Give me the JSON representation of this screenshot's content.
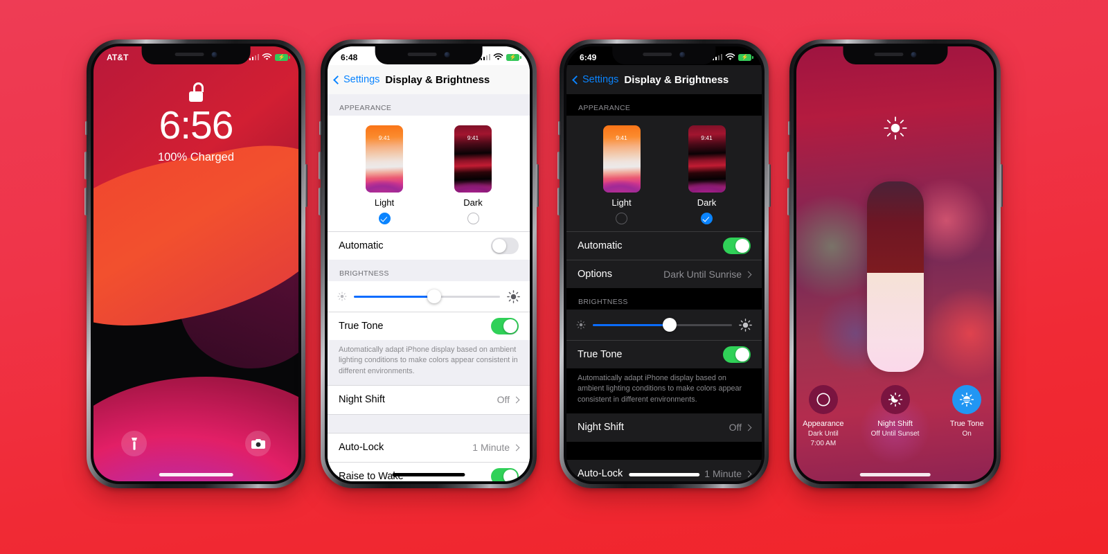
{
  "background": {
    "top_color": "#ee3c55",
    "bottom_color": "#f1242a"
  },
  "accent": {
    "blue": "#0a84ff",
    "green": "#30d158",
    "slider_blue": "#0a6cff"
  },
  "phone1": {
    "name": "lock-screen",
    "statusbar": {
      "carrier": "AT&T",
      "battery_charging": true
    },
    "time": "6:56",
    "charge_status": "100% Charged",
    "unlock_icon": "unlock-icon",
    "left_action_icon": "flashlight-icon",
    "right_action_icon": "camera-icon"
  },
  "phone2": {
    "name": "display-brightness-light",
    "statusbar": {
      "time": "6:48",
      "battery_charging": true
    },
    "nav": {
      "back_label": "Settings",
      "title": "Display & Brightness"
    },
    "appearance": {
      "header": "APPEARANCE",
      "options": [
        {
          "label": "Light",
          "selected": true,
          "thumb_time": "9:41"
        },
        {
          "label": "Dark",
          "selected": false,
          "thumb_time": "9:41"
        }
      ],
      "automatic_label": "Automatic",
      "automatic_on": false
    },
    "brightness": {
      "header": "BRIGHTNESS",
      "slider_percent": 55,
      "true_tone_label": "True Tone",
      "true_tone_on": true,
      "footnote": "Automatically adapt iPhone display based on ambient lighting conditions to make colors appear consistent in different environments.",
      "night_shift_label": "Night Shift",
      "night_shift_value": "Off"
    },
    "lock_section": {
      "auto_lock_label": "Auto-Lock",
      "auto_lock_value": "1 Minute",
      "raise_to_wake_label": "Raise to Wake",
      "raise_to_wake_on": true
    }
  },
  "phone3": {
    "name": "display-brightness-dark",
    "statusbar": {
      "time": "6:49",
      "battery_charging": true
    },
    "nav": {
      "back_label": "Settings",
      "title": "Display & Brightness"
    },
    "appearance": {
      "header": "APPEARANCE",
      "options": [
        {
          "label": "Light",
          "selected": false,
          "thumb_time": "9:41"
        },
        {
          "label": "Dark",
          "selected": true,
          "thumb_time": "9:41"
        }
      ],
      "automatic_label": "Automatic",
      "automatic_on": true,
      "options_label": "Options",
      "options_value": "Dark Until Sunrise"
    },
    "brightness": {
      "header": "BRIGHTNESS",
      "slider_percent": 55,
      "true_tone_label": "True Tone",
      "true_tone_on": true,
      "footnote": "Automatically adapt iPhone display based on ambient lighting conditions to make colors appear consistent in different environments.",
      "night_shift_label": "Night Shift",
      "night_shift_value": "Off"
    },
    "lock_section": {
      "auto_lock_label": "Auto-Lock",
      "auto_lock_value": "1 Minute"
    }
  },
  "phone4": {
    "name": "control-center-brightness",
    "top_icon": "sun-icon",
    "brightness_slider": {
      "fill_percent": 52
    },
    "tiles": [
      {
        "icon": "appearance-icon",
        "name": "Appearance",
        "state": "Dark Until\n7:00 AM",
        "active": false,
        "color": "#7a1440"
      },
      {
        "icon": "night-shift-icon",
        "name": "Night Shift",
        "state": "Off Until Sunset",
        "active": false,
        "color": "#7a1440"
      },
      {
        "icon": "true-tone-icon",
        "name": "True Tone",
        "state": "On",
        "active": true,
        "color": "#2196f3"
      }
    ]
  }
}
